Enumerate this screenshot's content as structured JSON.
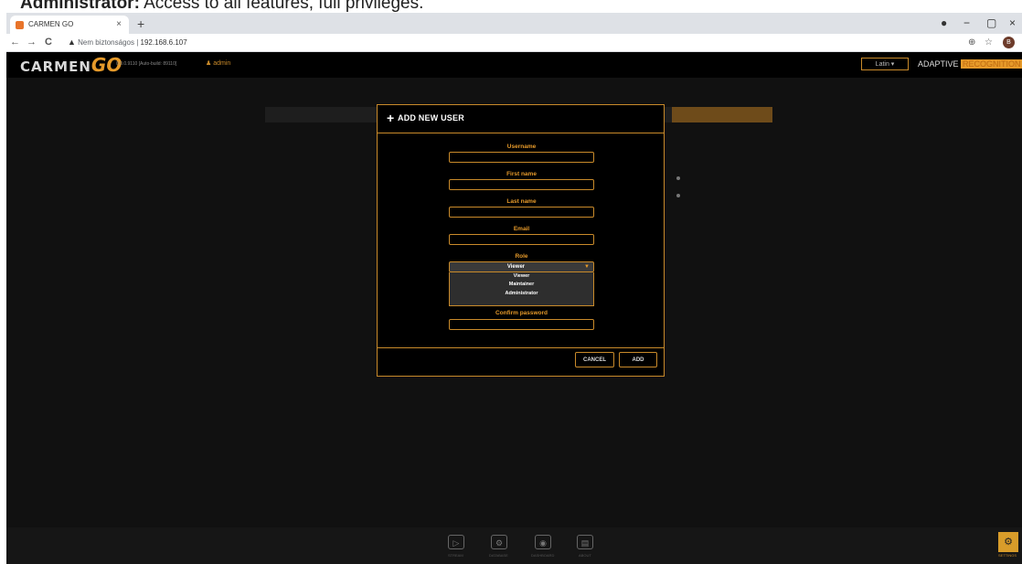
{
  "caption": {
    "bold": "Administrator:",
    "rest": " Access to all features, full privileges."
  },
  "browser": {
    "tab_title": "CARMEN GO",
    "tab_close": "×",
    "new_tab": "+",
    "back": "←",
    "forward": "→",
    "reload": "C",
    "security_icon": "▲",
    "security_text": "Nem biztonságos",
    "separator": "|",
    "url": "192.168.6.107",
    "zoom_icon": "⊕",
    "star_icon": "☆",
    "profile_initial": "B",
    "win_profile": "●",
    "win_min": "−",
    "win_max": "▢",
    "win_close": "×"
  },
  "app": {
    "logo": "CARMEN",
    "logo_go": "GO",
    "version": "0.0.0.9110 [Auto-build: 89110]",
    "user_icon": "♟",
    "username": "admin",
    "language": "Latin",
    "brand_left": "ADAPTIVE",
    "brand_right": "RECOGNITION"
  },
  "modal": {
    "plus_icon": "+",
    "title": "ADD NEW USER",
    "username_label": "Username",
    "firstname_label": "First name",
    "lastname_label": "Last name",
    "email_label": "Email",
    "role_label": "Role",
    "role_selected": "Viewer",
    "role_caret": "▼",
    "role_options": [
      "Viewer",
      "Maintainer",
      "Administrator"
    ],
    "confirm_label": "Confirm password",
    "cancel": "CANCEL",
    "add": "ADD"
  },
  "bottom": {
    "items": [
      "STREAM",
      "DATABASE",
      "DASHBOARD",
      "ABOUT"
    ],
    "icons": [
      "▷",
      "⚙",
      "◉",
      "▤"
    ],
    "settings_icon": "⚙",
    "settings_label": "SETTINGS"
  }
}
